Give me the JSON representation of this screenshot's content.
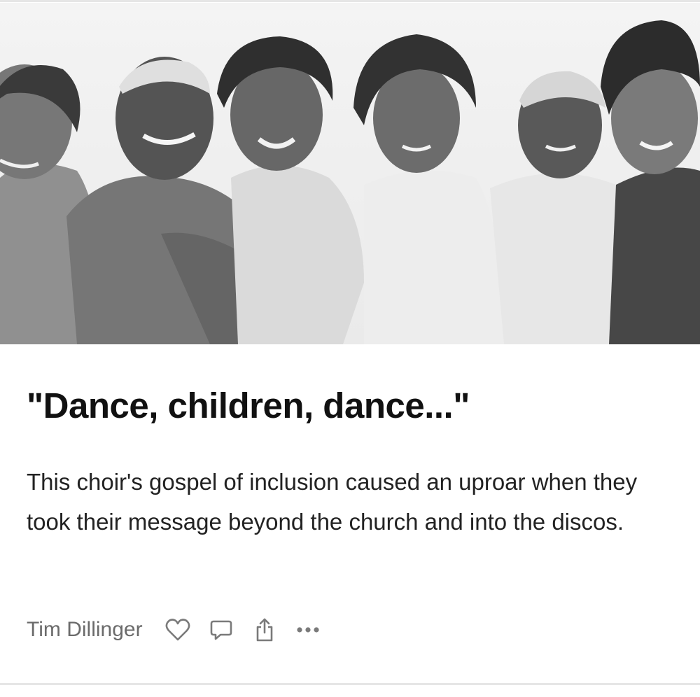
{
  "post": {
    "title": "\"Dance, children, dance...\"",
    "subtitle": "This choir's gospel of inclusion caused an uproar when they took their message beyond the church and into the discos.",
    "author": "Tim Dillinger",
    "hero_image": "black-and-white group photo of six choir members"
  },
  "actions": [
    {
      "icon": "heart-icon"
    },
    {
      "icon": "comment-icon"
    },
    {
      "icon": "share-icon"
    },
    {
      "icon": "more-icon"
    }
  ],
  "colors": {
    "title": "#111111",
    "body": "#222222",
    "meta": "#6b6b6b",
    "icon": "#7a7a7a"
  }
}
